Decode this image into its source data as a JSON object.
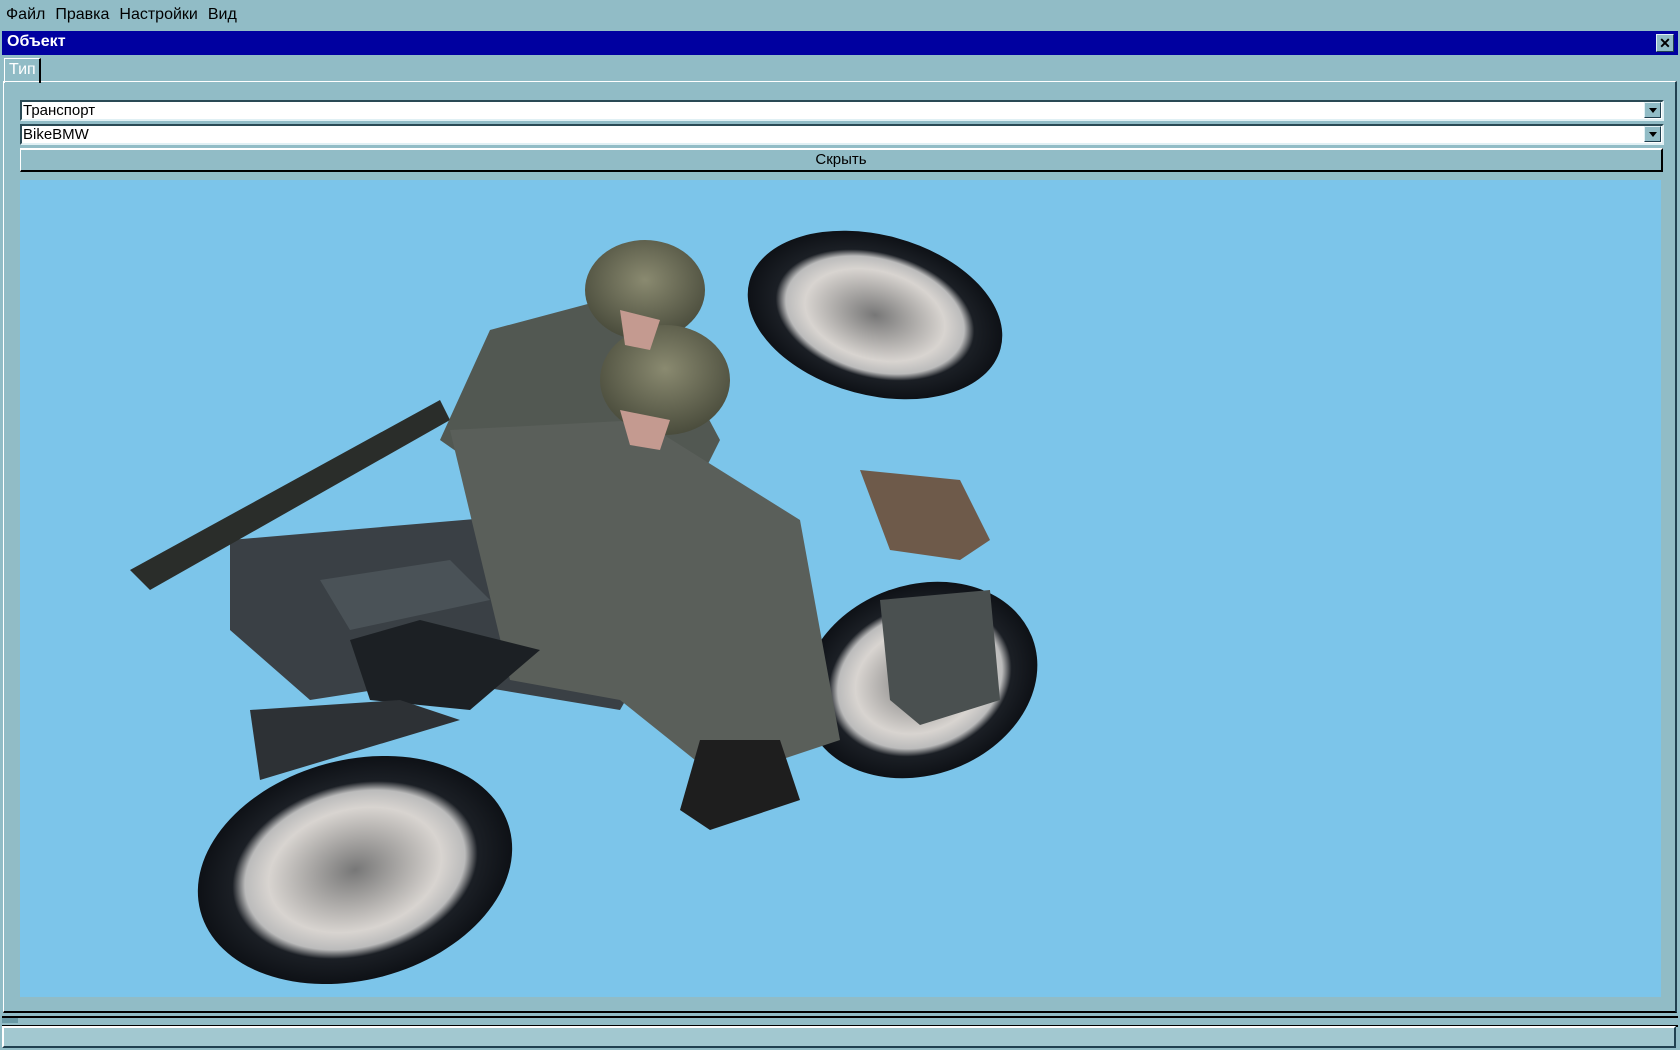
{
  "menu": [
    "Файл",
    "Правка",
    "Настройки",
    "Вид"
  ],
  "window": {
    "title": "Объект",
    "close_icon": "close-icon"
  },
  "tabs": [
    {
      "label": "Тип",
      "active": true
    }
  ],
  "category_select": {
    "value": "Транспорт"
  },
  "model_select": {
    "value": "BikeBMW"
  },
  "hide_button": {
    "label": "Скрыть"
  },
  "colors": {
    "titlebar": "#0000a0",
    "background": "#91bcc6",
    "viewport": "#7cc5ea"
  }
}
